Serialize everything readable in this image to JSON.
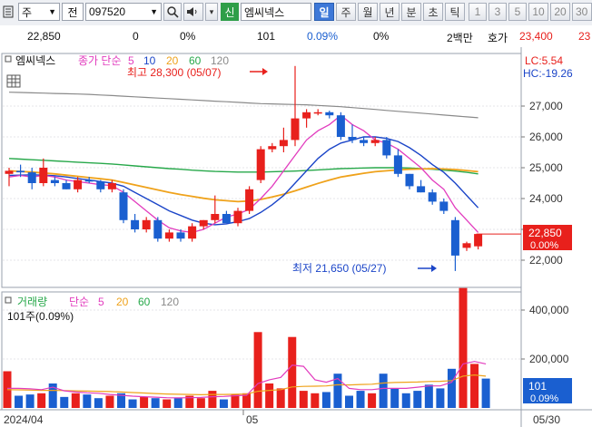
{
  "toolbar": {
    "market": "주",
    "type": "전",
    "code": "097520",
    "new_badge": "신",
    "stock_name": "엠씨넥스",
    "periods": [
      "일",
      "주",
      "월",
      "년",
      "분",
      "초",
      "틱"
    ],
    "numbers": [
      "1",
      "3",
      "5",
      "10",
      "20",
      "30"
    ],
    "active_period": "일"
  },
  "infobar": {
    "price": "22,850",
    "change": "0",
    "change_pct": "0%",
    "volume": "101",
    "volume_pct": "0.09%",
    "turnover_pct": "0%",
    "unit": "2백만",
    "quote_label": "호가",
    "ask": "23,400",
    "bid": "23"
  },
  "price_panel": {
    "title": "엠씨넥스",
    "indicator": "종가 단순",
    "ma_periods": [
      "5",
      "10",
      "20",
      "60",
      "120"
    ],
    "high_note": "최고 28,300 (05/07)",
    "low_note": "최저 21,650 (05/27)",
    "lc": "LC:5.54",
    "hc": "HC:-19.26",
    "y_ticks": [
      "27,000",
      "26,000",
      "25,000",
      "24,000",
      "23,000",
      "22,000"
    ],
    "current_price": "22,850",
    "current_pct": "0.00%"
  },
  "volume_panel": {
    "title": "거래량",
    "indicator": "단순",
    "ma_periods": [
      "5",
      "20",
      "60",
      "120"
    ],
    "current_label": "101주(0.09%)",
    "y_ticks": [
      "400,000",
      "200,000"
    ],
    "current_volume": "101",
    "current_pct": "0.09%"
  },
  "x_axis": {
    "labels": [
      "2024/04",
      "05",
      "05/30"
    ]
  },
  "colors": {
    "up": "#e8201c",
    "down": "#1a5fd0",
    "ma5": "#e23cbe",
    "ma10": "#1b45c8",
    "ma20": "#efa21b",
    "ma60": "#27a84a",
    "ma120": "#8a8a8a",
    "active": "#3d78d8"
  },
  "chart_data": {
    "type": "candlestick",
    "candles": [
      {
        "o": 24800,
        "h": 25000,
        "l": 24400,
        "c": 24900
      },
      {
        "o": 24900,
        "h": 25100,
        "l": 24700,
        "c": 24850
      },
      {
        "o": 24850,
        "h": 25000,
        "l": 24300,
        "c": 24500
      },
      {
        "o": 24500,
        "h": 25300,
        "l": 24400,
        "c": 25000
      },
      {
        "o": 24600,
        "h": 24700,
        "l": 24400,
        "c": 24500
      },
      {
        "o": 24500,
        "h": 24600,
        "l": 24300,
        "c": 24300
      },
      {
        "o": 24300,
        "h": 24700,
        "l": 24200,
        "c": 24600
      },
      {
        "o": 24600,
        "h": 24700,
        "l": 24500,
        "c": 24550
      },
      {
        "o": 24550,
        "h": 24600,
        "l": 24200,
        "c": 24300
      },
      {
        "o": 24300,
        "h": 24600,
        "l": 24200,
        "c": 24500
      },
      {
        "o": 24200,
        "h": 24300,
        "l": 23200,
        "c": 23300
      },
      {
        "o": 23300,
        "h": 23500,
        "l": 22900,
        "c": 23000
      },
      {
        "o": 23000,
        "h": 23400,
        "l": 22900,
        "c": 23300
      },
      {
        "o": 23300,
        "h": 23400,
        "l": 22600,
        "c": 22700
      },
      {
        "o": 22700,
        "h": 23000,
        "l": 22600,
        "c": 22900
      },
      {
        "o": 22900,
        "h": 23000,
        "l": 22600,
        "c": 22700
      },
      {
        "o": 22700,
        "h": 23200,
        "l": 22600,
        "c": 23100
      },
      {
        "o": 23100,
        "h": 23300,
        "l": 23000,
        "c": 23300
      },
      {
        "o": 23300,
        "h": 24100,
        "l": 23200,
        "c": 23500
      },
      {
        "o": 23500,
        "h": 23600,
        "l": 23200,
        "c": 23200
      },
      {
        "o": 23200,
        "h": 23700,
        "l": 23100,
        "c": 23600
      },
      {
        "o": 23600,
        "h": 24400,
        "l": 23500,
        "c": 24300
      },
      {
        "o": 24600,
        "h": 25700,
        "l": 24500,
        "c": 25600
      },
      {
        "o": 25600,
        "h": 25800,
        "l": 25500,
        "c": 25700
      },
      {
        "o": 25700,
        "h": 26300,
        "l": 25500,
        "c": 25900
      },
      {
        "o": 25900,
        "h": 28300,
        "l": 25700,
        "c": 26600
      },
      {
        "o": 26600,
        "h": 26900,
        "l": 26300,
        "c": 26800
      },
      {
        "o": 26800,
        "h": 26900,
        "l": 26700,
        "c": 26800
      },
      {
        "o": 26800,
        "h": 26850,
        "l": 26600,
        "c": 26700
      },
      {
        "o": 26700,
        "h": 26800,
        "l": 25900,
        "c": 26000
      },
      {
        "o": 26000,
        "h": 26400,
        "l": 25800,
        "c": 25900
      },
      {
        "o": 25900,
        "h": 26000,
        "l": 25700,
        "c": 25800
      },
      {
        "o": 25800,
        "h": 26000,
        "l": 25700,
        "c": 25900
      },
      {
        "o": 25900,
        "h": 26000,
        "l": 25300,
        "c": 25400
      },
      {
        "o": 25400,
        "h": 25600,
        "l": 24700,
        "c": 24800
      },
      {
        "o": 24800,
        "h": 24800,
        "l": 24300,
        "c": 24400
      },
      {
        "o": 24400,
        "h": 24600,
        "l": 24200,
        "c": 24200
      },
      {
        "o": 24200,
        "h": 24300,
        "l": 23800,
        "c": 23900
      },
      {
        "o": 23900,
        "h": 24000,
        "l": 23500,
        "c": 23600
      },
      {
        "o": 23300,
        "h": 23400,
        "l": 21650,
        "c": 22150
      },
      {
        "o": 22400,
        "h": 22600,
        "l": 22300,
        "c": 22550
      },
      {
        "o": 22450,
        "h": 22850,
        "l": 22350,
        "c": 22850
      }
    ],
    "ma5": [
      24700,
      24750,
      24700,
      24750,
      24700,
      24600,
      24550,
      24500,
      24450,
      24420,
      24200,
      23900,
      23600,
      23300,
      23050,
      22950,
      22900,
      23000,
      23200,
      23400,
      23500,
      23650,
      24000,
      24400,
      24900,
      25400,
      25900,
      26200,
      26400,
      26700,
      26400,
      26200,
      25900,
      25800,
      25600,
      25300,
      25000,
      24600,
      24300,
      23700,
      23300,
      22900
    ],
    "ma10": [
      24750,
      24760,
      24770,
      24760,
      24740,
      24700,
      24650,
      24600,
      24550,
      24500,
      24400,
      24200,
      24000,
      23800,
      23600,
      23450,
      23300,
      23200,
      23150,
      23180,
      23250,
      23350,
      23550,
      23800,
      24100,
      24500,
      24900,
      25300,
      25600,
      25800,
      25900,
      26000,
      26000,
      25950,
      25850,
      25650,
      25400,
      25100,
      24850,
      24500,
      24100,
      23700
    ],
    "ma20": [
      24900,
      24880,
      24860,
      24830,
      24800,
      24760,
      24720,
      24680,
      24640,
      24600,
      24520,
      24440,
      24360,
      24280,
      24200,
      24130,
      24070,
      24010,
      23960,
      23930,
      23900,
      23920,
      23970,
      24050,
      24140,
      24250,
      24370,
      24490,
      24600,
      24700,
      24760,
      24820,
      24870,
      24900,
      24930,
      24950,
      24960,
      24970,
      24960,
      24940,
      24910,
      24870
    ],
    "ma60": [
      25300,
      25280,
      25260,
      25240,
      25220,
      25200,
      25180,
      25160,
      25140,
      25120,
      25090,
      25060,
      25030,
      25000,
      24970,
      24950,
      24920,
      24900,
      24880,
      24870,
      24860,
      24860,
      24860,
      24870,
      24880,
      24890,
      24910,
      24930,
      24950,
      24970,
      24980,
      24990,
      25000,
      25000,
      25000,
      24990,
      24970,
      24950,
      24920,
      24890,
      24850,
      24800
    ],
    "ma120": [
      27450,
      27440,
      27430,
      27420,
      27410,
      27400,
      27390,
      27380,
      27360,
      27340,
      27320,
      27300,
      27280,
      27260,
      27240,
      27220,
      27200,
      27180,
      27160,
      27140,
      27120,
      27100,
      27080,
      27070,
      27060,
      27050,
      27040,
      27020,
      27000,
      26980,
      26950,
      26920,
      26890,
      26860,
      26830,
      26800,
      26770,
      26740,
      26710,
      26680,
      26650,
      26620
    ],
    "volume": [
      150000,
      50000,
      55000,
      60000,
      100000,
      45000,
      60000,
      55000,
      40000,
      50000,
      60000,
      35000,
      45000,
      40000,
      35000,
      40000,
      50000,
      40000,
      70000,
      35000,
      55000,
      60000,
      310000,
      100000,
      80000,
      290000,
      70000,
      60000,
      65000,
      140000,
      50000,
      70000,
      60000,
      140000,
      80000,
      60000,
      70000,
      95000,
      80000,
      160000,
      490000,
      180000,
      120000
    ],
    "vol_ma5": [
      80000,
      80000,
      78000,
      75000,
      85000,
      70000,
      65000,
      62000,
      60000,
      55000,
      52000,
      48000,
      46000,
      44000,
      42000,
      41000,
      42000,
      43000,
      46000,
      47000,
      50000,
      52000,
      100000,
      115000,
      125000,
      175000,
      170000,
      115000,
      105000,
      120000,
      80000,
      75000,
      75000,
      80000,
      80000,
      80000,
      85000,
      90000,
      90000,
      105000,
      180000,
      190000,
      180000
    ],
    "vol_ma20": [
      75000,
      74000,
      73000,
      72000,
      72000,
      71000,
      70000,
      69000,
      68000,
      67000,
      65000,
      63000,
      61000,
      59000,
      57000,
      56000,
      55000,
      54000,
      55000,
      55000,
      56000,
      57000,
      68000,
      72000,
      75000,
      86000,
      88000,
      89000,
      90000,
      95000,
      94000,
      96000,
      97000,
      102000,
      104000,
      105000,
      106000,
      108000,
      109000,
      112000,
      130000,
      135000,
      130000
    ]
  }
}
